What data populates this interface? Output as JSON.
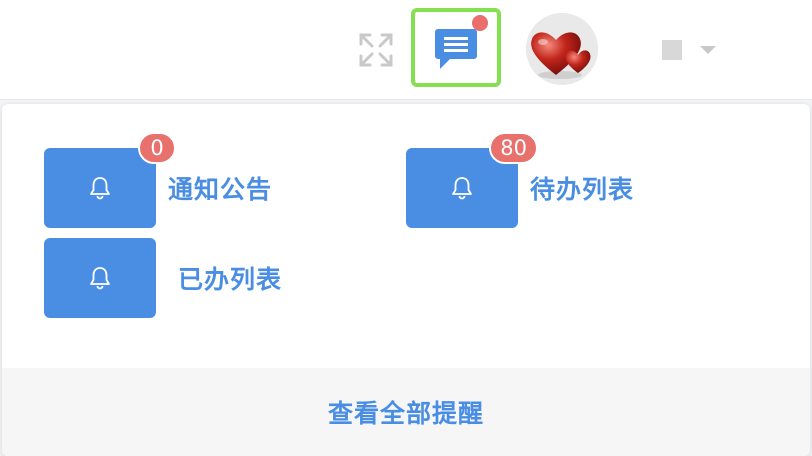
{
  "header": {
    "fullscreen_icon": "expand-arrows-icon",
    "messages_icon": "chat-message-icon",
    "messages_has_unread": true,
    "avatar_icon": "red-hearts-avatar",
    "user_menu_icon": "chevron-down-icon"
  },
  "notification_panel": {
    "items": [
      {
        "label": "通知公告",
        "badge": "0",
        "icon": "bell-icon"
      },
      {
        "label": "待办列表",
        "badge": "80",
        "icon": "bell-icon"
      },
      {
        "label": "已办列表",
        "icon": "bell-icon"
      }
    ],
    "view_all_label": "查看全部提醒"
  },
  "colors": {
    "accent_blue": "#4a8ee4",
    "badge_red": "#e8706d",
    "highlight_green": "#84e04f"
  }
}
